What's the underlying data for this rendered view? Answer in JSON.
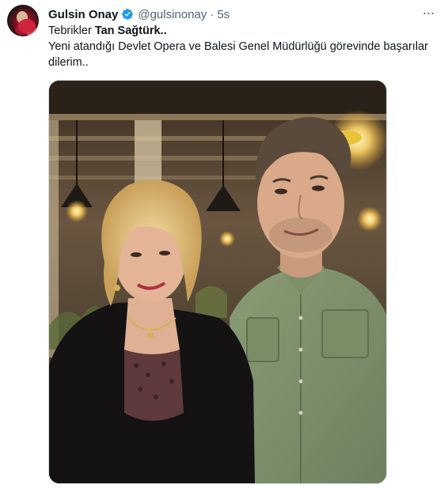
{
  "tweet": {
    "author_name": "Gulsin Onay",
    "handle": "@gulsinonay",
    "separator": "·",
    "time": "5s",
    "more_label": "···",
    "text_line1_prefix": "Tebrikler ",
    "text_line1_mention": "Tan Sağtürk",
    "text_line1_suffix": "..",
    "text_line2": "Yeni atandığı Devlet Opera ve Balesi Genel Müdürlüğü görevinde başarılar dilerim.."
  },
  "colors": {
    "verified": "#1d9bf0",
    "secondary_text": "#536471",
    "primary_text": "#0f1419"
  }
}
